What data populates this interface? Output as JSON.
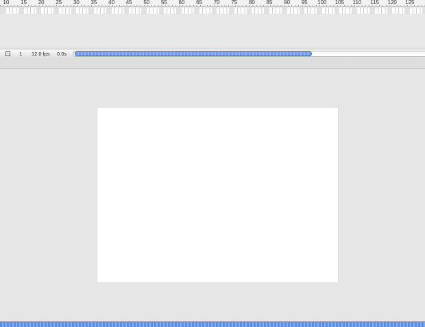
{
  "ruler": {
    "labels": [
      "10",
      "15",
      "20",
      "25",
      "30",
      "35",
      "40",
      "45",
      "50",
      "55",
      "60",
      "65",
      "70",
      "75",
      "80",
      "85",
      "90",
      "95",
      "100",
      "105",
      "110",
      "115",
      "120",
      "125"
    ]
  },
  "status": {
    "current_frame": "1",
    "frame_rate": "12.0 fps",
    "elapsed_time": "0.0s"
  },
  "icons": {
    "center_frame": "center-frame-icon"
  },
  "colors": {
    "scroll_thumb": "#6f9ee8",
    "stage": "#ffffff",
    "background": "#e6e6e6"
  }
}
